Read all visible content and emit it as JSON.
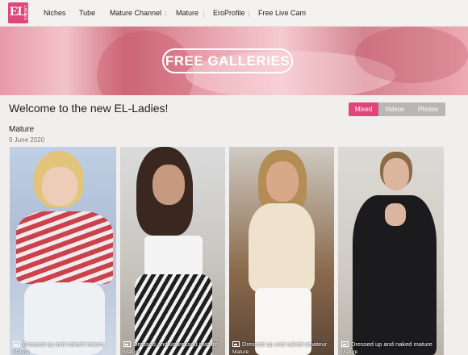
{
  "header": {
    "logo": {
      "mark": "EL",
      "sub": "LADIES"
    },
    "nav": [
      "Niches",
      "Tube",
      "Mature Channel",
      "Mature",
      "EroProfile",
      "Free Live Cam"
    ]
  },
  "banner": {
    "button_label": "FREE GALLERIES"
  },
  "welcome_text": "Welcome to the new EL-Ladies!",
  "filter": {
    "mixed": "Mixed",
    "videos": "Videos",
    "photos": "Photos",
    "active": "Mixed"
  },
  "section": {
    "title": "Mature",
    "date": "9 June 2020"
  },
  "cards": [
    {
      "caption": "Dressed up and naked mature",
      "tag": "Mature",
      "icon": "image-icon"
    },
    {
      "caption": "Dressed and undressed mature",
      "tag": "Mature",
      "icon": "image-icon"
    },
    {
      "caption": "Dressed up and naked amateur",
      "tag": "Mature",
      "icon": "image-icon"
    },
    {
      "caption": "Dressed up and naked mature",
      "tag": "Mature",
      "icon": "image-icon"
    }
  ],
  "colors": {
    "accent": "#e2457b",
    "banner_pink": "#e79aa7",
    "inactive_tab": "#b9b7b4"
  }
}
